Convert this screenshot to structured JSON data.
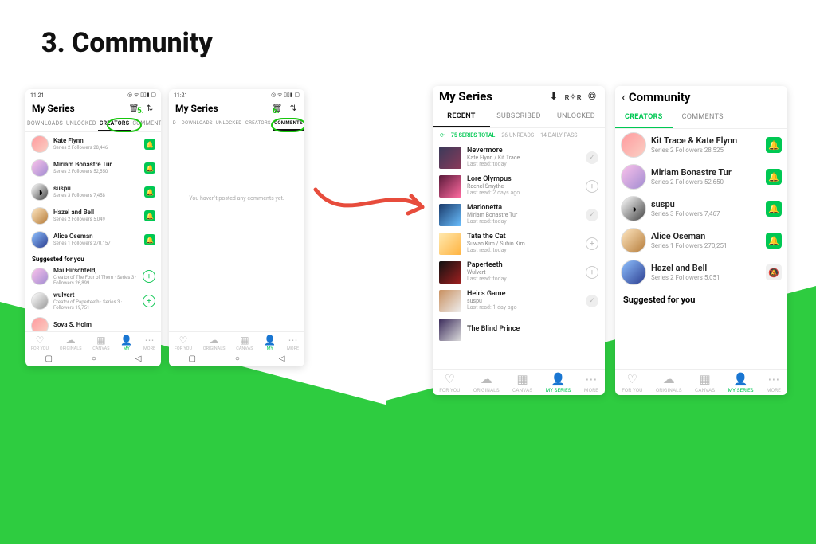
{
  "slide": {
    "title": "3. Community"
  },
  "annotations": {
    "num5": "5.",
    "num6": "6."
  },
  "status": {
    "time": "11:21",
    "right_glyphs": "◎ ᯤ ▯▯▮ ▢"
  },
  "nav": {
    "for_you": "FOR YOU",
    "originals": "ORIGINALS",
    "canvas": "CANVAS",
    "my": "MY",
    "my_series": "MY SERIES",
    "more": "MORE"
  },
  "phone1": {
    "title": "My Series",
    "tabs": {
      "downloads": "DOWNLOADS",
      "unlocked": "UNLOCKED",
      "creators": "CREATORS",
      "comments": "COMMENTS"
    },
    "creators": [
      {
        "name": "Kate Flynn",
        "sub": "Series 2   Followers 28,446"
      },
      {
        "name": "Miriam Bonastre Tur",
        "sub": "Series 2   Followers 52,550"
      },
      {
        "name": "suspu",
        "sub": "Series 3   Followers 7,458"
      },
      {
        "name": "Hazel and Bell",
        "sub": "Series 2   Followers 5,049"
      },
      {
        "name": "Alice Oseman",
        "sub": "Series 1   Followers 270,157"
      }
    ],
    "suggested_label": "Suggested for you",
    "suggested": [
      {
        "name": "Mai Hirschfeld,",
        "sub": "Creator of The Four of Them · Series 3 · Followers 26,899"
      },
      {
        "name": "wulvert",
        "sub": "Creator of Paperteeth · Series 3 · Followers 19,751"
      },
      {
        "name": "Sova S. Holm",
        "sub": ""
      }
    ]
  },
  "phone2": {
    "title": "My Series",
    "tabs": {
      "d": "D",
      "downloads": "DOWNLOADS",
      "unlocked": "UNLOCKED",
      "creators": "CREATORS",
      "comments": "COMMENTS"
    },
    "empty": "You haven't posted any comments yet."
  },
  "phone3": {
    "title": "My Series",
    "tabs": {
      "recent": "RECENT",
      "subscribed": "SUBSCRIBED",
      "unlocked": "UNLOCKED"
    },
    "counts": {
      "total": "75 SERIES TOTAL",
      "unreads": "26 UNREADS",
      "daily": "14 DAILY PASS"
    },
    "series": [
      {
        "title": "Nevermore",
        "author": "Kate Flynn / Kit Trace",
        "last": "Last read: today",
        "state": "check"
      },
      {
        "title": "Lore Olympus",
        "author": "Rachel Smythe",
        "last": "Last read: 2 days ago",
        "state": "add"
      },
      {
        "title": "Marionetta",
        "author": "Miriam Bonastre Tur",
        "last": "Last read: today",
        "state": "check"
      },
      {
        "title": "Tata the Cat",
        "author": "Suwan Kim / Subin Kim",
        "last": "Last read: today",
        "state": "add"
      },
      {
        "title": "Paperteeth",
        "author": "Wulvert",
        "last": "Last read: today",
        "state": "add"
      },
      {
        "title": "Heir's Game",
        "author": "suspu",
        "last": "Last read: 1 day ago",
        "state": "check"
      },
      {
        "title": "The Blind Prince",
        "author": "",
        "last": "",
        "state": ""
      }
    ]
  },
  "phone4": {
    "title": "Community",
    "tabs": {
      "creators": "CREATORS",
      "comments": "COMMENTS"
    },
    "creators": [
      {
        "name": "Kit Trace & Kate Flynn",
        "sub": "Series 2     Followers 28,525",
        "bell": "on"
      },
      {
        "name": "Miriam Bonastre Tur",
        "sub": "Series 2     Followers 52,650",
        "bell": "on"
      },
      {
        "name": "suspu",
        "sub": "Series 3     Followers 7,467",
        "bell": "on"
      },
      {
        "name": "Alice Oseman",
        "sub": "Series 1     Followers 270,251",
        "bell": "on"
      },
      {
        "name": "Hazel and Bell",
        "sub": "Series 2     Followers 5,051",
        "bell": "off"
      }
    ],
    "suggested_label": "Suggested for you"
  }
}
